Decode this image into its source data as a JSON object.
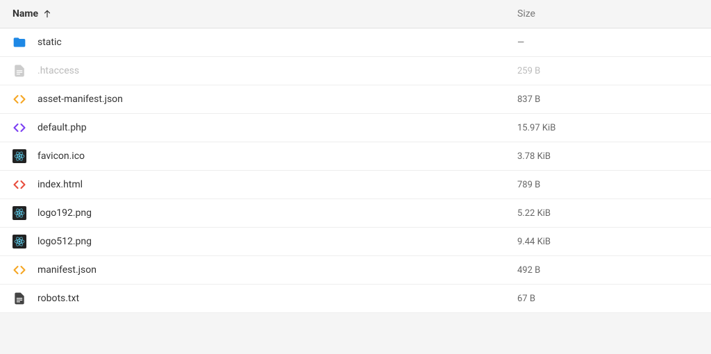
{
  "header": {
    "name_label": "Name",
    "size_label": "Size",
    "sort_direction": "ascending"
  },
  "files": [
    {
      "icon": "folder",
      "name": "static",
      "size": "—",
      "dimmed": false
    },
    {
      "icon": "doc-grey",
      "name": ".htaccess",
      "size": "259 B",
      "dimmed": true
    },
    {
      "icon": "code-orange",
      "name": "asset-manifest.json",
      "size": "837 B",
      "dimmed": false
    },
    {
      "icon": "code-purple",
      "name": "default.php",
      "size": "15.97 KiB",
      "dimmed": false
    },
    {
      "icon": "react",
      "name": "favicon.ico",
      "size": "3.78 KiB",
      "dimmed": false
    },
    {
      "icon": "code-red",
      "name": "index.html",
      "size": "789 B",
      "dimmed": false
    },
    {
      "icon": "react",
      "name": "logo192.png",
      "size": "5.22 KiB",
      "dimmed": false
    },
    {
      "icon": "react",
      "name": "logo512.png",
      "size": "9.44 KiB",
      "dimmed": false
    },
    {
      "icon": "code-orange",
      "name": "manifest.json",
      "size": "492 B",
      "dimmed": false
    },
    {
      "icon": "doc-dark",
      "name": "robots.txt",
      "size": "67 B",
      "dimmed": false
    }
  ]
}
